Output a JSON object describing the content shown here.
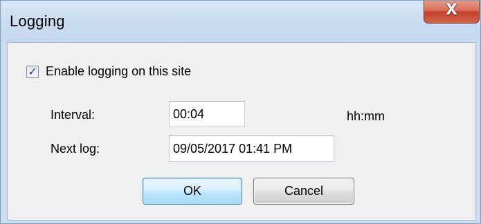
{
  "window": {
    "title": "Logging",
    "close_glyph": "X",
    "close_icon": "close-icon"
  },
  "enable_logging": {
    "checked": true,
    "check_glyph": "✓",
    "label": "Enable logging on this site"
  },
  "interval": {
    "label": "Interval:",
    "value": "00:04",
    "unit": "hh:mm"
  },
  "next_log": {
    "label": "Next log:",
    "value": "09/05/2017 01:41 PM"
  },
  "buttons": {
    "ok": "OK",
    "cancel": "Cancel"
  },
  "colors": {
    "client_bg": "#f0f0f0",
    "frame": "#c9dcf0",
    "close_red": "#c4412a",
    "checkmark": "#2d3f8c",
    "ok_border": "#3c7fb1"
  }
}
